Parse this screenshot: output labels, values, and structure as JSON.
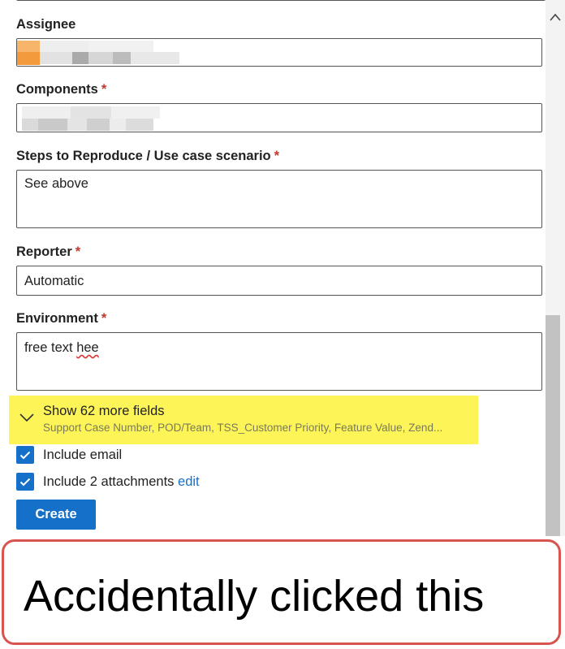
{
  "form": {
    "assignee": {
      "label": "Assignee"
    },
    "components": {
      "label": "Components",
      "required_mark": "*"
    },
    "steps": {
      "label": "Steps to Reproduce / Use case scenario",
      "required_mark": "*",
      "value": "See above"
    },
    "reporter": {
      "label": "Reporter",
      "required_mark": "*",
      "value": "Automatic"
    },
    "environment": {
      "label": "Environment",
      "required_mark": "*",
      "value_prefix": "free text ",
      "value_misspelled": "hee"
    }
  },
  "more_fields": {
    "title": "Show 62 more fields",
    "subtitle": "Support Case Number, POD/Team, TSS_Customer Priority, Feature Value, Zend..."
  },
  "options": {
    "include_email": {
      "label": "Include email",
      "checked": true
    },
    "include_attachments": {
      "label": "Include 2 attachments",
      "link": "edit",
      "checked": true
    }
  },
  "actions": {
    "create_label": "Create"
  },
  "annotation": {
    "text": "Accidentally clicked this"
  },
  "colors": {
    "accent": "#1470c8",
    "required": "#c0392b",
    "highlight": "#fdf458",
    "annotation_border": "#d9534f"
  }
}
